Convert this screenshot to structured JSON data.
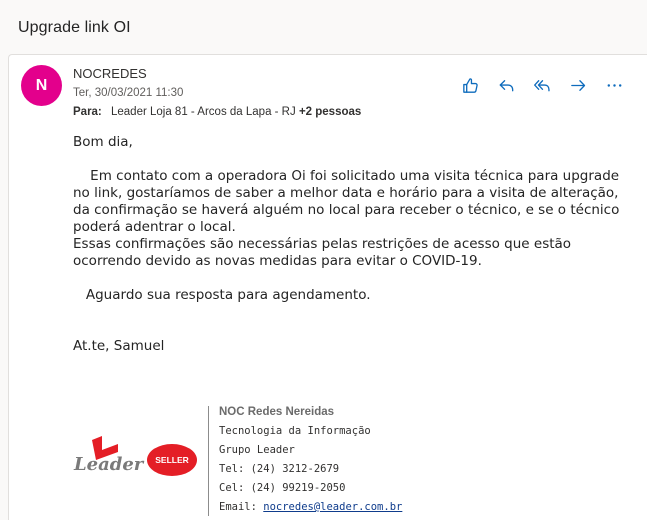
{
  "subject": "Upgrade link OI",
  "sender": {
    "initial": "N",
    "name": "NOCREDES",
    "date": "Ter, 30/03/2021 11:30",
    "to_label": "Para:",
    "to_value": "Leader Loja 81 - Arcos da Lapa - RJ",
    "to_more": "+2 pessoas",
    "avatar_color": "#e3008c"
  },
  "actions": [
    {
      "name": "like",
      "icon": "thumbs-up-icon"
    },
    {
      "name": "reply",
      "icon": "reply-icon"
    },
    {
      "name": "reply-all",
      "icon": "reply-all-icon"
    },
    {
      "name": "forward",
      "icon": "forward-icon"
    },
    {
      "name": "more",
      "icon": "more-icon"
    }
  ],
  "body": "Bom dia,\n\n    Em contato com a operadora Oi foi solicitado uma visita técnica para upgrade no link, gostaríamos de saber a melhor data e horário para a visita de alteração, da confirmação se haverá alguém no local para receber o técnico, e se o técnico poderá adentrar o local.\nEssas confirmações são necessárias pelas restrições de acesso que estão ocorrendo devido as novas medidas para evitar o COVID-19.\n\n   Aguardo sua resposta para agendamento.\n\n\nAt.te, Samuel",
  "logos": {
    "leader": "Leader",
    "seller": "SELLER"
  },
  "signature": {
    "name": "NOC Redes Nereidas",
    "dept": "Tecnologia da Informação",
    "company": "Grupo Leader",
    "tel": "Tel: (24) 3212-2679",
    "cel": "Cel: (24) 99219-2050",
    "email_label": "Email: ",
    "email": "nocredes@leader.com.br"
  },
  "colors": {
    "accent": "#0f6cbd",
    "seller_red": "#e41e26"
  }
}
